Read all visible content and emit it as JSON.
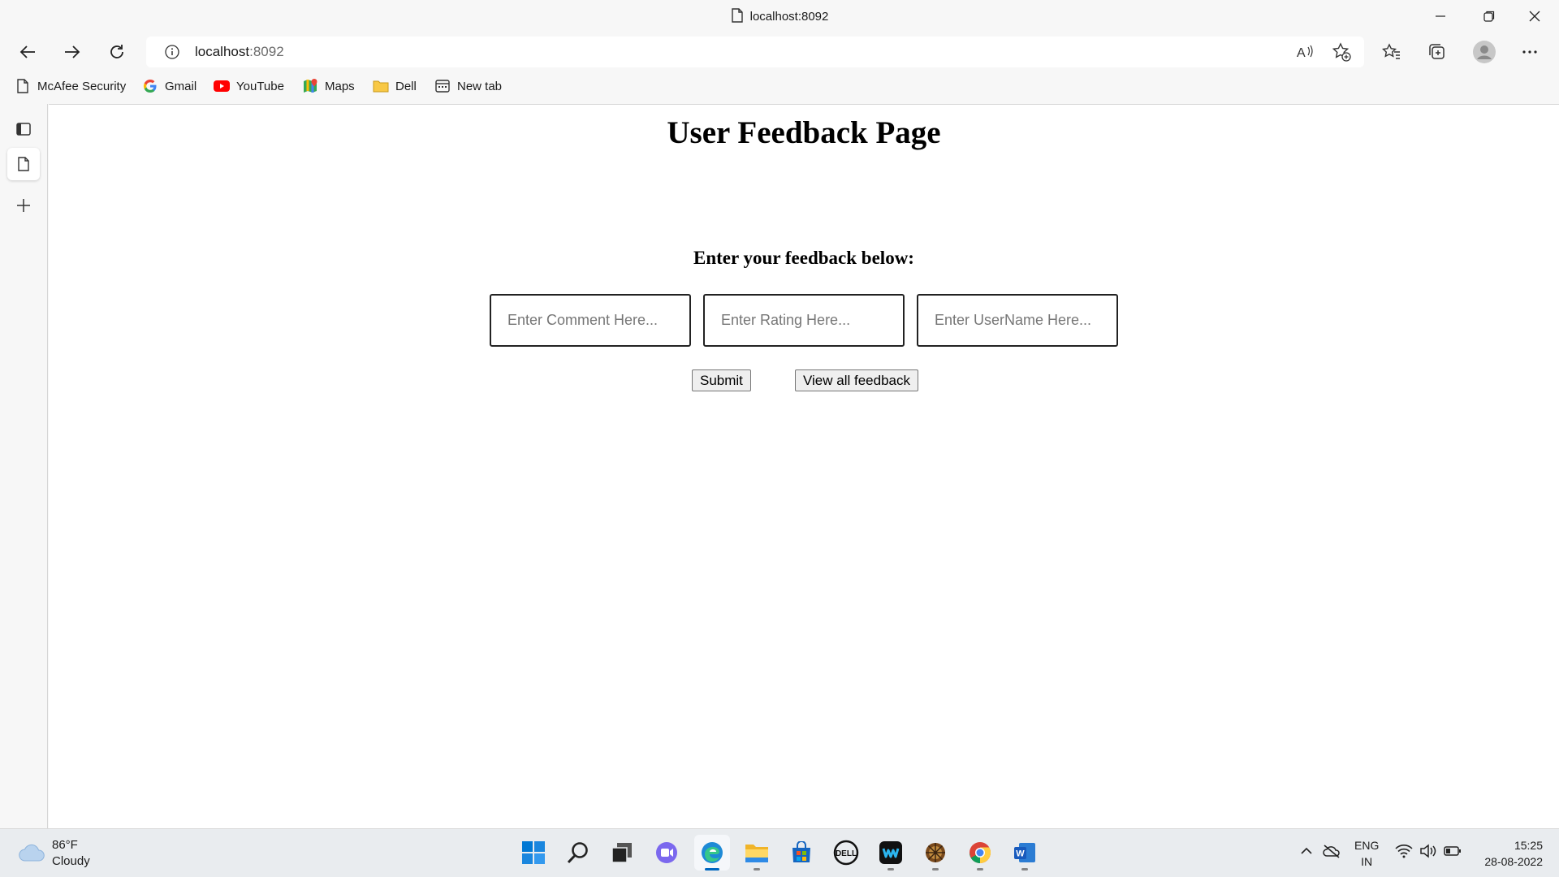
{
  "window": {
    "title": "localhost:8092",
    "controls": [
      "minimize-icon",
      "restore-icon",
      "close-icon"
    ]
  },
  "toolbar": {
    "address_host": "localhost",
    "address_port": ":8092",
    "buttons": [
      "back-icon",
      "forward-icon",
      "refresh-icon",
      "read-aloud-icon",
      "add-favorite-icon",
      "favorites-icon",
      "collections-icon",
      "profile-icon",
      "more-icon"
    ]
  },
  "favorites": [
    {
      "label": "McAfee Security",
      "icon": "page-icon"
    },
    {
      "label": "Gmail",
      "icon": "google-icon"
    },
    {
      "label": "YouTube",
      "icon": "youtube-icon"
    },
    {
      "label": "Maps",
      "icon": "maps-icon"
    },
    {
      "label": "Dell",
      "icon": "folder-icon"
    },
    {
      "label": "New tab",
      "icon": "new-tab-icon"
    }
  ],
  "page": {
    "title": "User Feedback Page",
    "subtitle": "Enter your feedback below:",
    "inputs": {
      "comment_placeholder": "Enter Comment Here...",
      "rating_placeholder": "Enter Rating Here...",
      "username_placeholder": "Enter UserName Here..."
    },
    "buttons": {
      "submit": "Submit",
      "view_all": "View all feedback"
    }
  },
  "taskbar": {
    "weather": {
      "temp": "86°F",
      "condition": "Cloudy"
    },
    "language": {
      "line1": "ENG",
      "line2": "IN"
    },
    "clock": {
      "time": "15:25",
      "date": "28-08-2022"
    }
  },
  "colors": {
    "accent": "#0067c0",
    "page_background": "#ffffff",
    "chrome_background": "#f7f7f7"
  }
}
